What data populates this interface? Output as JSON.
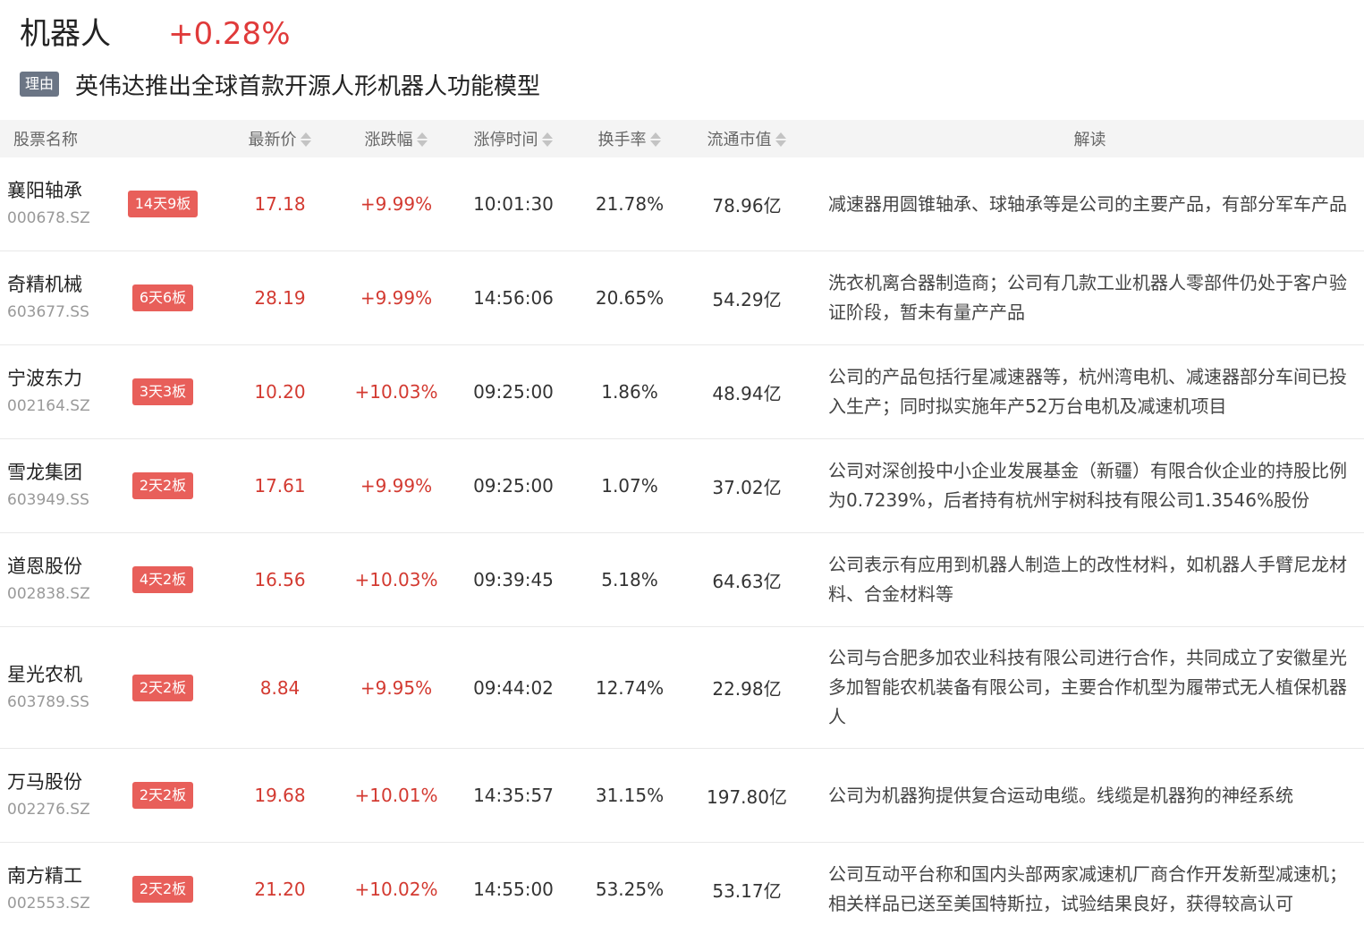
{
  "header": {
    "sector_name": "机器人",
    "sector_change": "+0.28%",
    "reason_badge": "理由",
    "reason_text": "英伟达推出全球首款开源人形机器人功能模型"
  },
  "table": {
    "columns": {
      "name": "股票名称",
      "price": "最新价",
      "change": "涨跌幅",
      "limit_time": "涨停时间",
      "turnover": "换手率",
      "market_cap": "流通市值",
      "interpretation": "解读"
    },
    "rows": [
      {
        "name": "襄阳轴承",
        "code": "000678.SZ",
        "board": "14天9板",
        "price": "17.18",
        "change": "+9.99%",
        "limit_time": "10:01:30",
        "turnover": "21.78%",
        "market_cap": "78.96亿",
        "desc": "减速器用圆锥轴承、球轴承等是公司的主要产品，有部分军车产品"
      },
      {
        "name": "奇精机械",
        "code": "603677.SS",
        "board": "6天6板",
        "price": "28.19",
        "change": "+9.99%",
        "limit_time": "14:56:06",
        "turnover": "20.65%",
        "market_cap": "54.29亿",
        "desc": "洗衣机离合器制造商；公司有几款工业机器人零部件仍处于客户验证阶段，暂未有量产产品"
      },
      {
        "name": "宁波东力",
        "code": "002164.SZ",
        "board": "3天3板",
        "price": "10.20",
        "change": "+10.03%",
        "limit_time": "09:25:00",
        "turnover": "1.86%",
        "market_cap": "48.94亿",
        "desc": "公司的产品包括行星减速器等，杭州湾电机、减速器部分车间已投入生产；同时拟实施年产52万台电机及减速机项目"
      },
      {
        "name": "雪龙集团",
        "code": "603949.SS",
        "board": "2天2板",
        "price": "17.61",
        "change": "+9.99%",
        "limit_time": "09:25:00",
        "turnover": "1.07%",
        "market_cap": "37.02亿",
        "desc": "公司对深创投中小企业发展基金（新疆）有限合伙企业的持股比例为0.7239%，后者持有杭州宇树科技有限公司1.3546%股份"
      },
      {
        "name": "道恩股份",
        "code": "002838.SZ",
        "board": "4天2板",
        "price": "16.56",
        "change": "+10.03%",
        "limit_time": "09:39:45",
        "turnover": "5.18%",
        "market_cap": "64.63亿",
        "desc": "公司表示有应用到机器人制造上的改性材料，如机器人手臂尼龙材料、合金材料等"
      },
      {
        "name": "星光农机",
        "code": "603789.SS",
        "board": "2天2板",
        "price": "8.84",
        "change": "+9.95%",
        "limit_time": "09:44:02",
        "turnover": "12.74%",
        "market_cap": "22.98亿",
        "desc": "公司与合肥多加农业科技有限公司进行合作，共同成立了安徽星光多加智能农机装备有限公司，主要合作机型为履带式无人植保机器人"
      },
      {
        "name": "万马股份",
        "code": "002276.SZ",
        "board": "2天2板",
        "price": "19.68",
        "change": "+10.01%",
        "limit_time": "14:35:57",
        "turnover": "31.15%",
        "market_cap": "197.80亿",
        "desc": "公司为机器狗提供复合运动电缆。线缆是机器狗的神经系统"
      },
      {
        "name": "南方精工",
        "code": "002553.SZ",
        "board": "2天2板",
        "price": "21.20",
        "change": "+10.02%",
        "limit_time": "14:55:00",
        "turnover": "53.25%",
        "market_cap": "53.17亿",
        "desc": "公司互动平台称和国内头部两家减速机厂商合作开发新型减速机；相关样品已送至美国特斯拉，试验结果良好，获得较高认可"
      }
    ]
  },
  "colors": {
    "up": "#d33a31",
    "board_badge": "#e85f5a",
    "reason_badge": "#6b7585",
    "header_bg": "#f4f4f4"
  }
}
